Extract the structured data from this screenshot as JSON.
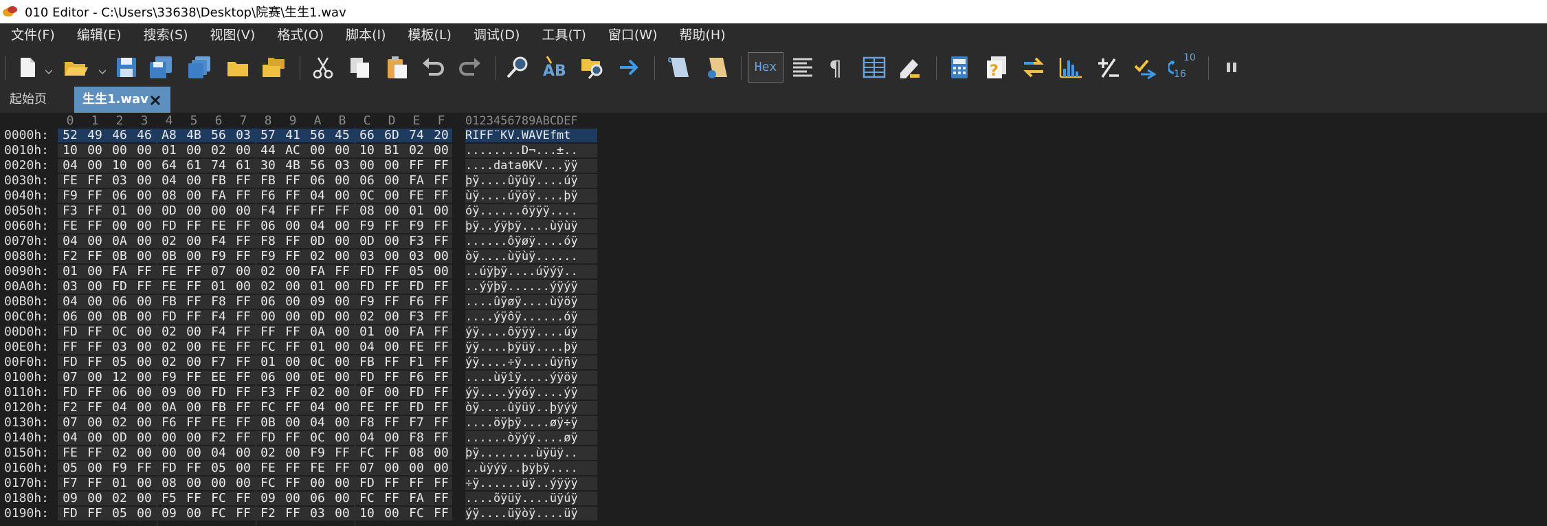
{
  "window": {
    "title": "010 Editor - C:\\Users\\33638\\Desktop\\院赛\\生生1.wav"
  },
  "menu": [
    "文件(F)",
    "编辑(E)",
    "搜索(S)",
    "视图(V)",
    "格式(O)",
    "脚本(I)",
    "模板(L)",
    "调试(D)",
    "工具(T)",
    "窗口(W)",
    "帮助(H)"
  ],
  "toolbar": {
    "hex_label": "Hex",
    "base_top": "10",
    "base_bottom": "16"
  },
  "tabs": {
    "start": "起始页",
    "file": "生生1.wav"
  },
  "hex": {
    "columns": [
      "0",
      "1",
      "2",
      "3",
      "4",
      "5",
      "6",
      "7",
      "8",
      "9",
      "A",
      "B",
      "C",
      "D",
      "E",
      "F"
    ],
    "ascii_header": "0123456789ABCDEF",
    "rows": [
      {
        "addr": "0000h:",
        "bytes": "52 49 46 46 A8 4B 56 03 57 41 56 45 66 6D 74 20",
        "ascii": "RIFF¨KV.WAVEfmt "
      },
      {
        "addr": "0010h:",
        "bytes": "10 00 00 00 01 00 02 00 44 AC 00 00 10 B1 02 00",
        "ascii": "........D¬...±.."
      },
      {
        "addr": "0020h:",
        "bytes": "04 00 10 00 64 61 74 61 30 4B 56 03 00 00 FF FF",
        "ascii": "....data0KV...ÿÿ"
      },
      {
        "addr": "0030h:",
        "bytes": "FE FF 03 00 04 00 FB FF FB FF 06 00 06 00 FA FF",
        "ascii": "þÿ....ûÿûÿ....úÿ"
      },
      {
        "addr": "0040h:",
        "bytes": "F9 FF 06 00 08 00 FA FF F6 FF 04 00 0C 00 FE FF",
        "ascii": "ùÿ....úÿöÿ....þÿ"
      },
      {
        "addr": "0050h:",
        "bytes": "F3 FF 01 00 0D 00 00 00 F4 FF FF FF 08 00 01 00",
        "ascii": "óÿ......ôÿÿÿ...."
      },
      {
        "addr": "0060h:",
        "bytes": "FE FF 00 00 FD FF FE FF 06 00 04 00 F9 FF F9 FF",
        "ascii": "þÿ..ýÿþÿ....ùÿùÿ"
      },
      {
        "addr": "0070h:",
        "bytes": "04 00 0A 00 02 00 F4 FF F8 FF 0D 00 0D 00 F3 FF",
        "ascii": "......ôÿøÿ....óÿ"
      },
      {
        "addr": "0080h:",
        "bytes": "F2 FF 0B 00 0B 00 F9 FF F9 FF 02 00 03 00 03 00",
        "ascii": "òÿ....ùÿùÿ......"
      },
      {
        "addr": "0090h:",
        "bytes": "01 00 FA FF FE FF 07 00 02 00 FA FF FD FF 05 00",
        "ascii": "..úÿþÿ....úÿýÿ.."
      },
      {
        "addr": "00A0h:",
        "bytes": "03 00 FD FF FE FF 01 00 02 00 01 00 FD FF FD FF",
        "ascii": "..ýÿþÿ......ýÿýÿ"
      },
      {
        "addr": "00B0h:",
        "bytes": "04 00 06 00 FB FF F8 FF 06 00 09 00 F9 FF F6 FF",
        "ascii": "....ûÿøÿ....ùÿöÿ"
      },
      {
        "addr": "00C0h:",
        "bytes": "06 00 0B 00 FD FF F4 FF 00 00 0D 00 02 00 F3 FF",
        "ascii": "....ýÿôÿ......óÿ"
      },
      {
        "addr": "00D0h:",
        "bytes": "FD FF 0C 00 02 00 F4 FF FF FF 0A 00 01 00 FA FF",
        "ascii": "ýÿ....ôÿÿÿ....úÿ"
      },
      {
        "addr": "00E0h:",
        "bytes": "FF FF 03 00 02 00 FE FF FC FF 01 00 04 00 FE FF",
        "ascii": "ÿÿ....þÿüÿ....þÿ"
      },
      {
        "addr": "00F0h:",
        "bytes": "FD FF 05 00 02 00 F7 FF 01 00 0C 00 FB FF F1 FF",
        "ascii": "ýÿ....÷ÿ....ûÿñÿ"
      },
      {
        "addr": "0100h:",
        "bytes": "07 00 12 00 F9 FF EE FF 06 00 0E 00 FD FF F6 FF",
        "ascii": "....ùÿîÿ....ýÿöÿ"
      },
      {
        "addr": "0110h:",
        "bytes": "FD FF 06 00 09 00 FD FF F3 FF 02 00 0F 00 FD FF",
        "ascii": "ýÿ....ýÿóÿ....ýÿ"
      },
      {
        "addr": "0120h:",
        "bytes": "F2 FF 04 00 0A 00 FB FF FC FF 04 00 FE FF FD FF",
        "ascii": "òÿ....ûÿüÿ..þÿýÿ"
      },
      {
        "addr": "0130h:",
        "bytes": "07 00 02 00 F6 FF FE FF 0B 00 04 00 F8 FF F7 FF",
        "ascii": "....öÿþÿ....øÿ÷ÿ"
      },
      {
        "addr": "0140h:",
        "bytes": "04 00 0D 00 00 00 F2 FF FD FF 0C 00 04 00 F8 FF",
        "ascii": "......òÿýÿ....øÿ"
      },
      {
        "addr": "0150h:",
        "bytes": "FE FF 02 00 00 00 04 00 02 00 F9 FF FC FF 08 00",
        "ascii": "þÿ........ùÿüÿ.."
      },
      {
        "addr": "0160h:",
        "bytes": "05 00 F9 FF FD FF 05 00 FE FF FE FF 07 00 00 00",
        "ascii": "..ùÿýÿ..þÿþÿ...."
      },
      {
        "addr": "0170h:",
        "bytes": "F7 FF 01 00 08 00 00 00 FC FF 00 00 FD FF FF FF",
        "ascii": "÷ÿ......üÿ..ýÿÿÿ"
      },
      {
        "addr": "0180h:",
        "bytes": "09 00 02 00 F5 FF FC FF 09 00 06 00 FC FF FA FF",
        "ascii": "....õÿüÿ....üÿúÿ"
      },
      {
        "addr": "0190h:",
        "bytes": "FD FF 05 00 09 00 FC FF F2 FF 03 00 10 00 FC FF",
        "ascii": "ýÿ....üÿòÿ....üÿ"
      }
    ]
  },
  "colors": {
    "selection": "#1e3a5f",
    "tab_active": "#5d8fbf",
    "background": "#1e1e1e"
  }
}
